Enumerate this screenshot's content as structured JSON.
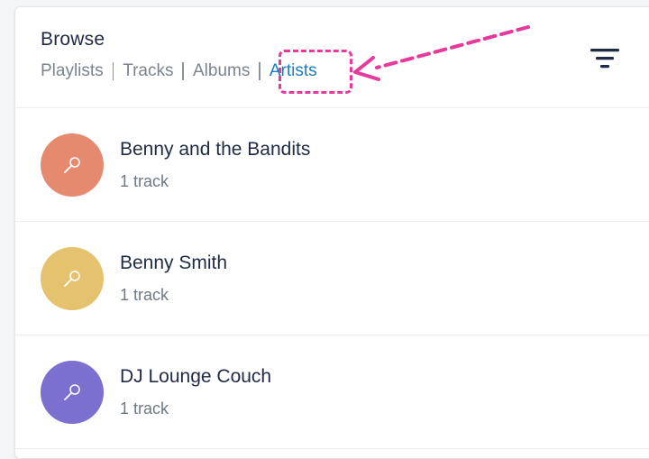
{
  "header": {
    "title": "Browse",
    "tabs": [
      {
        "label": "Playlists",
        "active": false
      },
      {
        "label": "Tracks",
        "active": false
      },
      {
        "label": "Albums",
        "active": false
      },
      {
        "label": "Artists",
        "active": true
      }
    ],
    "filter_icon": "filter-lines-icon"
  },
  "artists": [
    {
      "name": "Benny and the Bandits",
      "subtitle": "1 track",
      "color": "#e68a6f",
      "icon": "microphone-icon"
    },
    {
      "name": "Benny Smith",
      "subtitle": "1 track",
      "color": "#e5c36e",
      "icon": "microphone-icon"
    },
    {
      "name": "DJ Lounge Couch",
      "subtitle": "1 track",
      "color": "#7b6fcf",
      "icon": "microphone-icon"
    }
  ],
  "colors": {
    "accent": "#1a7fc1",
    "annotation": "#e5399b",
    "text": "#1f2a44",
    "muted": "#6f7884"
  }
}
